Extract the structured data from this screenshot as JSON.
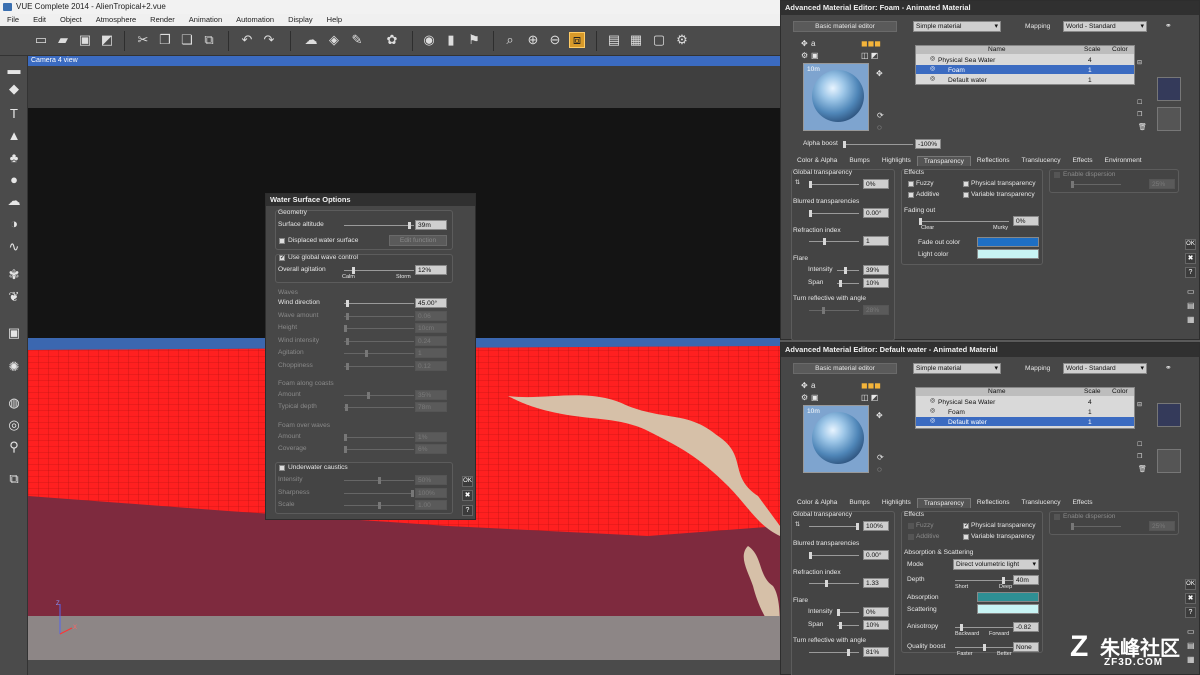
{
  "window": {
    "title": "VUE Complete 2014 - AlienTropical+2.vue",
    "menu": [
      "File",
      "Edit",
      "Object",
      "Atmosphere",
      "Render",
      "Animation",
      "Automation",
      "Display",
      "Help"
    ]
  },
  "viewport": {
    "label": "Camera 4 view",
    "axes": {
      "z": "Z",
      "x": "X"
    }
  },
  "water": {
    "title": "Water Surface Options",
    "geometry": {
      "header": "Geometry",
      "altitude_label": "Surface altitude",
      "altitude_value": "39m",
      "altitude_pos": 0.95,
      "displaced_label": "Displaced water surface",
      "edit_button": "Edit function"
    },
    "global": {
      "use_label": "Use global wave control",
      "agitation_label": "Overall agitation",
      "agitation_value": "12%",
      "agitation_pos": 0.12,
      "calm": "Calm",
      "storm": "Storm"
    },
    "waves": {
      "header": "Waves",
      "rows": [
        {
          "label": "Wind direction",
          "value": "45.00°",
          "pos": 0.03,
          "enabled": true
        },
        {
          "label": "Wave amount",
          "value": "0.06",
          "pos": 0.03,
          "enabled": false
        },
        {
          "label": "Height",
          "value": "10cm",
          "pos": 0.0,
          "enabled": false
        },
        {
          "label": "Wind intensity",
          "value": "0.24",
          "pos": 0.03,
          "enabled": false
        },
        {
          "label": "Agitation",
          "value": "1",
          "pos": 0.31,
          "enabled": false
        },
        {
          "label": "Choppiness",
          "value": "0.12",
          "pos": 0.03,
          "enabled": false
        }
      ]
    },
    "coasts": {
      "header": "Foam along coasts",
      "rows": [
        {
          "label": "Amount",
          "value": "35%",
          "pos": 0.35
        },
        {
          "label": "Typical depth",
          "value": "78m",
          "pos": 0.02
        }
      ]
    },
    "over": {
      "header": "Foam over waves",
      "rows": [
        {
          "label": "Amount",
          "value": "1%",
          "pos": 0.0
        },
        {
          "label": "Coverage",
          "value": "6%",
          "pos": 0.0
        }
      ]
    },
    "caustics": {
      "label": "Underwater caustics",
      "rows": [
        {
          "label": "Intensity",
          "value": "50%",
          "pos": 0.5
        },
        {
          "label": "Sharpness",
          "value": "100%",
          "pos": 1.0
        },
        {
          "label": "Scale",
          "value": "1.00",
          "pos": 0.5
        }
      ]
    },
    "side_buttons": {
      "ok": "OK",
      "cancel": "✖",
      "help": "?"
    }
  },
  "editor1": {
    "title": "Advanced Material Editor: Foam - Animated Material",
    "basic_btn": "Basic material editor",
    "type": "Simple material",
    "mapping_label": "Mapping",
    "mapping": "World - Standard",
    "preview_size": "10m",
    "alpha_label": "Alpha boost",
    "alpha_value": "-100%",
    "cols": {
      "name": "Name",
      "scale": "Scale",
      "color": "Color"
    },
    "rows": [
      {
        "name": "Physical Sea Water",
        "scale": "4"
      },
      {
        "name": "Foam",
        "scale": "1"
      },
      {
        "name": "Default water",
        "scale": "1"
      }
    ],
    "selected_row": 1,
    "tabs": [
      "Color & Alpha",
      "Bumps",
      "Highlights",
      "Transparency",
      "Reflections",
      "Translucency",
      "Effects",
      "Environment"
    ],
    "active_tab": 3,
    "gt_label": "Global transparency",
    "gt_value": "0%",
    "gt_pos": 0.0,
    "bt_label": "Blurred transparencies",
    "bt_value": "0.00°",
    "bt_pos": 0.0,
    "ri_label": "Refraction index",
    "ri_value": "1",
    "ri_pos": 0.3,
    "flare_label": "Flare",
    "intensity_label": "Intensity",
    "intensity_value": "39%",
    "intensity_pos": 0.39,
    "span_label": "Span",
    "span_value": "10%",
    "span_pos": 0.1,
    "turn_label": "Turn reflective with angle",
    "turn_value": "28%",
    "turn_pos": 0.28,
    "effects_label": "Effects",
    "fuzzy": "Fuzzy",
    "additive": "Additive",
    "phys": "Physical transparency",
    "variable": "Variable transparency",
    "fading_label": "Fading out",
    "fading_value": "0%",
    "fading_pos": 0.0,
    "clear": "Clear",
    "murky": "Murky",
    "fadecolor_label": "Fade out color",
    "lightcolor_label": "Light color",
    "fade_color": "#1e6fc4",
    "light_color": "#c8f4f4",
    "dispersion": "Enable dispersion",
    "disp_value": "25%"
  },
  "editor2": {
    "title": "Advanced Material Editor: Default water - Animated Material",
    "basic_btn": "Basic material editor",
    "type": "Simple material",
    "mapping_label": "Mapping",
    "mapping": "World - Standard",
    "preview_size": "10m",
    "cols": {
      "name": "Name",
      "scale": "Scale",
      "color": "Color"
    },
    "rows": [
      {
        "name": "Physical Sea Water",
        "scale": "4"
      },
      {
        "name": "Foam",
        "scale": "1"
      },
      {
        "name": "Default water",
        "scale": "1"
      }
    ],
    "selected_row": 2,
    "tabs": [
      "Color & Alpha",
      "Bumps",
      "Highlights",
      "Transparency",
      "Reflections",
      "Translucency",
      "Effects"
    ],
    "active_tab": 3,
    "gt_label": "Global transparency",
    "gt_value": "100%",
    "gt_pos": 1.0,
    "bt_label": "Blurred transparencies",
    "bt_value": "0.00°",
    "bt_pos": 0.0,
    "ri_label": "Refraction index",
    "ri_value": "1.33",
    "ri_pos": 0.33,
    "flare_label": "Flare",
    "intensity_label": "Intensity",
    "intensity_value": "0%",
    "intensity_pos": 0.0,
    "span_label": "Span",
    "span_value": "10%",
    "span_pos": 0.1,
    "turn_label": "Turn reflective with angle",
    "turn_value": "81%",
    "turn_pos": 0.81,
    "effects_label": "Effects",
    "fuzzy": "Fuzzy",
    "additive": "Additive",
    "phys": "Physical transparency",
    "variable": "Variable transparency",
    "abs_header": "Absorption & Scattering",
    "mode_label": "Mode",
    "mode": "Direct volumetric light",
    "depth_label": "Depth",
    "depth_value": "40m",
    "depth_pos": 0.85,
    "short": "Short",
    "deep": "Deep",
    "absorption_label": "Absorption",
    "scattering_label": "Scattering",
    "absorption_color": "#2e8f94",
    "scattering_color": "#c8f4f4",
    "aniso_label": "Anisotropy",
    "aniso_value": "-0.82",
    "aniso_pos": 0.09,
    "backward": "Backward",
    "forward": "Forward",
    "quality_label": "Quality boost",
    "quality_value": "None",
    "quality_pos": 0.5,
    "faster": "Faster",
    "better": "Better",
    "dispersion": "Enable dispersion",
    "disp_value": "25%"
  },
  "side": {
    "ok": "OK",
    "cancel": "✖",
    "help": "?"
  },
  "watermark": {
    "brand": "朱峰社区",
    "site": "ZF3D.COM"
  },
  "colors": {
    "ocean": "#ff1a1a",
    "ground": "#7e2a3e",
    "sky": "#1c1c1c",
    "horizon": "#3b67b0",
    "accent": "#3b6bc1"
  }
}
